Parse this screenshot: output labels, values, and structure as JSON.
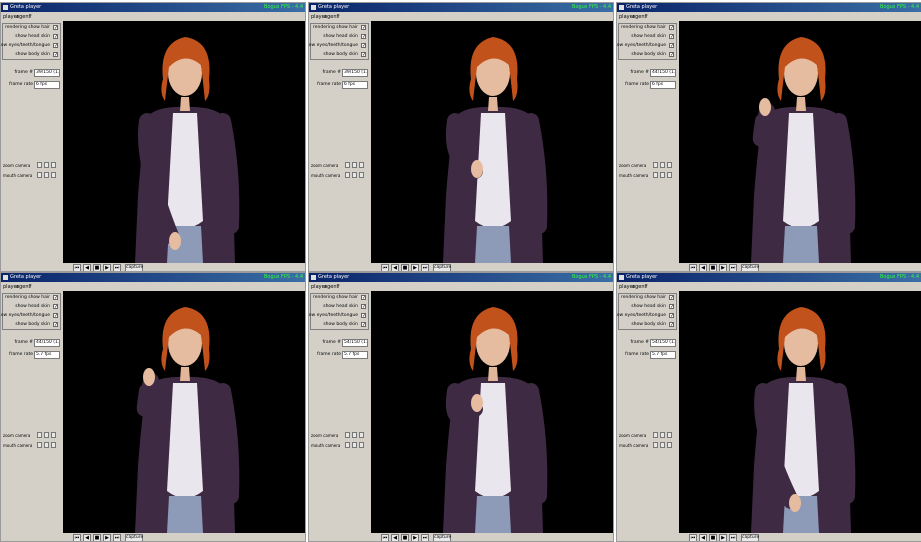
{
  "app": {
    "title": "Greta player",
    "fps": "Bogus FPS - 4.4",
    "menu": [
      "player",
      "agent",
      "?"
    ]
  },
  "options": {
    "rendering_label": "rendering",
    "items": [
      {
        "label": "show hair",
        "checked": true
      },
      {
        "label": "show head skin",
        "checked": true
      },
      {
        "label": "show eyes/teeth/tongue",
        "checked": true
      },
      {
        "label": "show body skin",
        "checked": true
      }
    ]
  },
  "fields": {
    "frame_label": "frame #",
    "rate_label": "frame rate"
  },
  "zoom": {
    "rows": [
      "zoom camera",
      "mouth camera"
    ]
  },
  "playback": {
    "buttons": [
      "⏮",
      "◀",
      "■",
      "▶",
      "⏭"
    ],
    "capture_label": "capture"
  },
  "windows": [
    {
      "frame": "39/150 (1.6s)",
      "rate": "6 fps",
      "pose": "rest"
    },
    {
      "frame": "39/150 (1.6s)",
      "rate": "6 fps",
      "pose": "raise-mid"
    },
    {
      "frame": "44/150 (1.8s)",
      "rate": "6 fps",
      "pose": "raise-high"
    },
    {
      "frame": "44/150 (1.8s)",
      "rate": "5.7 fps",
      "pose": "raise-high"
    },
    {
      "frame": "54/150 (1.8s)",
      "rate": "5.7 fps",
      "pose": "chest"
    },
    {
      "frame": "54/150 (1.8s)",
      "rate": "5.7 fps",
      "pose": "rest-low"
    }
  ],
  "colors": {
    "titlebar": "#0a246a",
    "panel": "#d4d0c8",
    "jacket": "#3f2a43",
    "hair": "#c2521c"
  }
}
